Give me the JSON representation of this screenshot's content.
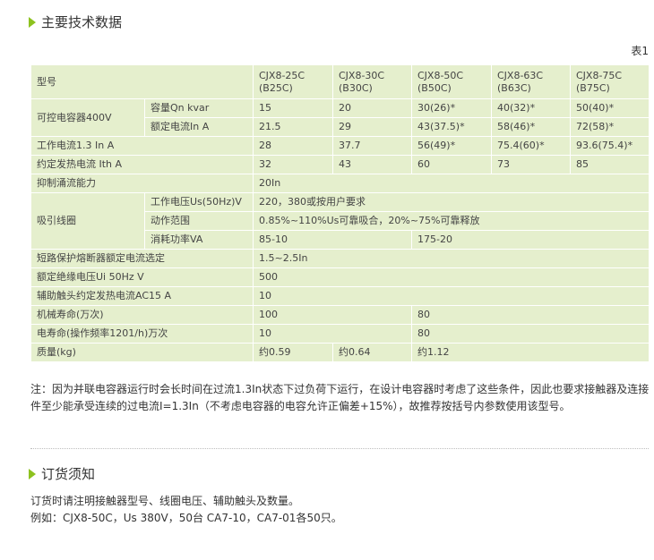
{
  "section1": {
    "title": "主要技术数据"
  },
  "table_label": "表1",
  "table": {
    "h_model": "型号",
    "models": [
      {
        "name": "CJX8-25C",
        "sub": "(B25C)"
      },
      {
        "name": "CJX8-30C",
        "sub": "(B30C)"
      },
      {
        "name": "CJX8-50C",
        "sub": "(B50C)"
      },
      {
        "name": "CJX8-63C",
        "sub": "(B63C)"
      },
      {
        "name": "CJX8-75C",
        "sub": "(B75C)"
      }
    ],
    "r_capacitor": "可控电容器400V",
    "r_capacity": "容量Qn kvar",
    "v_capacity": [
      "15",
      "20",
      "30(26)*",
      "40(32)*",
      "50(40)*"
    ],
    "r_current": "额定电流In A",
    "v_current": [
      "21.5",
      "29",
      "43(37.5)*",
      "58(46)*",
      "72(58)*"
    ],
    "r_work": "工作电流1.3 In A",
    "v_work": [
      "28",
      "37.7",
      "56(49)*",
      "75.4(60)*",
      "93.6(75.4)*"
    ],
    "r_ith": "约定发热电流 Ith A",
    "v_ith": [
      "32",
      "43",
      "60",
      "73",
      "85"
    ],
    "r_surge": "抑制涌流能力",
    "v_surge": "20In",
    "r_coil": "吸引线圈",
    "r_coil_voltage": "工作电压Us(50Hz)V",
    "v_coil_voltage": "220，380或按用户要求",
    "r_action": "动作范围",
    "v_action": "0.85%~110%Us可靠吸合，20%~75%可靠释放",
    "r_power": "消耗功率VA",
    "v_power": [
      "85-10",
      "175-20"
    ],
    "r_fuse": "短路保护熔断器额定电流选定",
    "v_fuse": "1.5~2.5In",
    "r_insulation": "额定绝缘电压Ui 50Hz V",
    "v_insulation": "500",
    "r_aux": "辅助触头约定发热电流AC15 A",
    "v_aux": "10",
    "r_mech": "机械寿命(万次)",
    "v_mech": [
      "100",
      "80"
    ],
    "r_elec": "电寿命(操作频率1201/h)万次",
    "v_elec": [
      "10",
      "80"
    ],
    "r_mass": "质量(kg)",
    "v_mass": [
      "约0.59",
      "约0.64",
      "约1.12"
    ]
  },
  "note": "注：因为并联电容器运行时会长时间在过流1.3In状态下过负荷下运行，在设计电容器时考虑了这些条件，因此也要求接触器及连接件至少能承受连续的过电流I=1.3In（不考虑电容器的电容允许正偏差+15%），故推荐按括号内参数使用该型号。",
  "section2": {
    "title": "订货须知"
  },
  "order": {
    "line1": "订货时请注明接触器型号、线圈电压、辅助触头及数量。",
    "line2": "例如：CJX8-50C，Us 380V，50台  CA7-10，CA7-01各50只。"
  },
  "colors": {
    "accent": "#8dc21f",
    "table_bg": "#e5efcd"
  }
}
